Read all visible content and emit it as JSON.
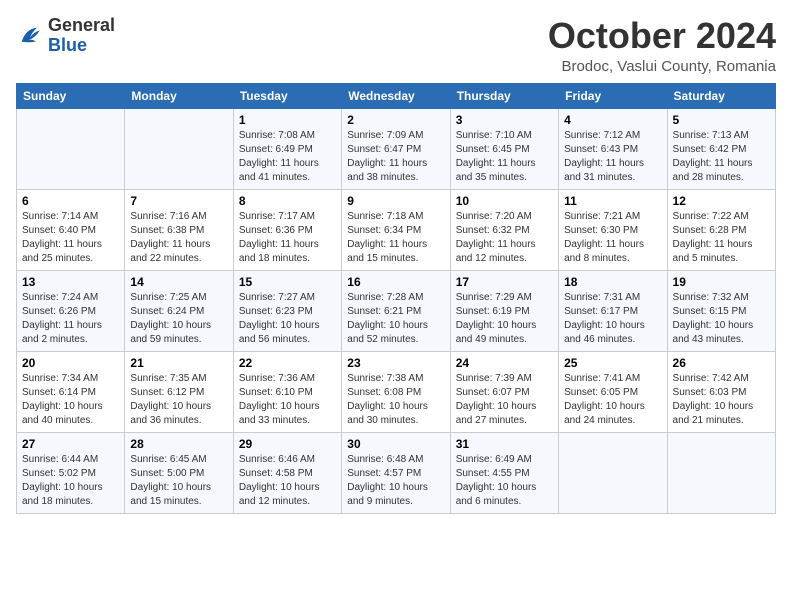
{
  "logo": {
    "general": "General",
    "blue": "Blue"
  },
  "title": "October 2024",
  "location": "Brodoc, Vaslui County, Romania",
  "days_of_week": [
    "Sunday",
    "Monday",
    "Tuesday",
    "Wednesday",
    "Thursday",
    "Friday",
    "Saturday"
  ],
  "weeks": [
    [
      {
        "day": "",
        "info": ""
      },
      {
        "day": "",
        "info": ""
      },
      {
        "day": "1",
        "info": "Sunrise: 7:08 AM\nSunset: 6:49 PM\nDaylight: 11 hours and 41 minutes."
      },
      {
        "day": "2",
        "info": "Sunrise: 7:09 AM\nSunset: 6:47 PM\nDaylight: 11 hours and 38 minutes."
      },
      {
        "day": "3",
        "info": "Sunrise: 7:10 AM\nSunset: 6:45 PM\nDaylight: 11 hours and 35 minutes."
      },
      {
        "day": "4",
        "info": "Sunrise: 7:12 AM\nSunset: 6:43 PM\nDaylight: 11 hours and 31 minutes."
      },
      {
        "day": "5",
        "info": "Sunrise: 7:13 AM\nSunset: 6:42 PM\nDaylight: 11 hours and 28 minutes."
      }
    ],
    [
      {
        "day": "6",
        "info": "Sunrise: 7:14 AM\nSunset: 6:40 PM\nDaylight: 11 hours and 25 minutes."
      },
      {
        "day": "7",
        "info": "Sunrise: 7:16 AM\nSunset: 6:38 PM\nDaylight: 11 hours and 22 minutes."
      },
      {
        "day": "8",
        "info": "Sunrise: 7:17 AM\nSunset: 6:36 PM\nDaylight: 11 hours and 18 minutes."
      },
      {
        "day": "9",
        "info": "Sunrise: 7:18 AM\nSunset: 6:34 PM\nDaylight: 11 hours and 15 minutes."
      },
      {
        "day": "10",
        "info": "Sunrise: 7:20 AM\nSunset: 6:32 PM\nDaylight: 11 hours and 12 minutes."
      },
      {
        "day": "11",
        "info": "Sunrise: 7:21 AM\nSunset: 6:30 PM\nDaylight: 11 hours and 8 minutes."
      },
      {
        "day": "12",
        "info": "Sunrise: 7:22 AM\nSunset: 6:28 PM\nDaylight: 11 hours and 5 minutes."
      }
    ],
    [
      {
        "day": "13",
        "info": "Sunrise: 7:24 AM\nSunset: 6:26 PM\nDaylight: 11 hours and 2 minutes."
      },
      {
        "day": "14",
        "info": "Sunrise: 7:25 AM\nSunset: 6:24 PM\nDaylight: 10 hours and 59 minutes."
      },
      {
        "day": "15",
        "info": "Sunrise: 7:27 AM\nSunset: 6:23 PM\nDaylight: 10 hours and 56 minutes."
      },
      {
        "day": "16",
        "info": "Sunrise: 7:28 AM\nSunset: 6:21 PM\nDaylight: 10 hours and 52 minutes."
      },
      {
        "day": "17",
        "info": "Sunrise: 7:29 AM\nSunset: 6:19 PM\nDaylight: 10 hours and 49 minutes."
      },
      {
        "day": "18",
        "info": "Sunrise: 7:31 AM\nSunset: 6:17 PM\nDaylight: 10 hours and 46 minutes."
      },
      {
        "day": "19",
        "info": "Sunrise: 7:32 AM\nSunset: 6:15 PM\nDaylight: 10 hours and 43 minutes."
      }
    ],
    [
      {
        "day": "20",
        "info": "Sunrise: 7:34 AM\nSunset: 6:14 PM\nDaylight: 10 hours and 40 minutes."
      },
      {
        "day": "21",
        "info": "Sunrise: 7:35 AM\nSunset: 6:12 PM\nDaylight: 10 hours and 36 minutes."
      },
      {
        "day": "22",
        "info": "Sunrise: 7:36 AM\nSunset: 6:10 PM\nDaylight: 10 hours and 33 minutes."
      },
      {
        "day": "23",
        "info": "Sunrise: 7:38 AM\nSunset: 6:08 PM\nDaylight: 10 hours and 30 minutes."
      },
      {
        "day": "24",
        "info": "Sunrise: 7:39 AM\nSunset: 6:07 PM\nDaylight: 10 hours and 27 minutes."
      },
      {
        "day": "25",
        "info": "Sunrise: 7:41 AM\nSunset: 6:05 PM\nDaylight: 10 hours and 24 minutes."
      },
      {
        "day": "26",
        "info": "Sunrise: 7:42 AM\nSunset: 6:03 PM\nDaylight: 10 hours and 21 minutes."
      }
    ],
    [
      {
        "day": "27",
        "info": "Sunrise: 6:44 AM\nSunset: 5:02 PM\nDaylight: 10 hours and 18 minutes."
      },
      {
        "day": "28",
        "info": "Sunrise: 6:45 AM\nSunset: 5:00 PM\nDaylight: 10 hours and 15 minutes."
      },
      {
        "day": "29",
        "info": "Sunrise: 6:46 AM\nSunset: 4:58 PM\nDaylight: 10 hours and 12 minutes."
      },
      {
        "day": "30",
        "info": "Sunrise: 6:48 AM\nSunset: 4:57 PM\nDaylight: 10 hours and 9 minutes."
      },
      {
        "day": "31",
        "info": "Sunrise: 6:49 AM\nSunset: 4:55 PM\nDaylight: 10 hours and 6 minutes."
      },
      {
        "day": "",
        "info": ""
      },
      {
        "day": "",
        "info": ""
      }
    ]
  ]
}
